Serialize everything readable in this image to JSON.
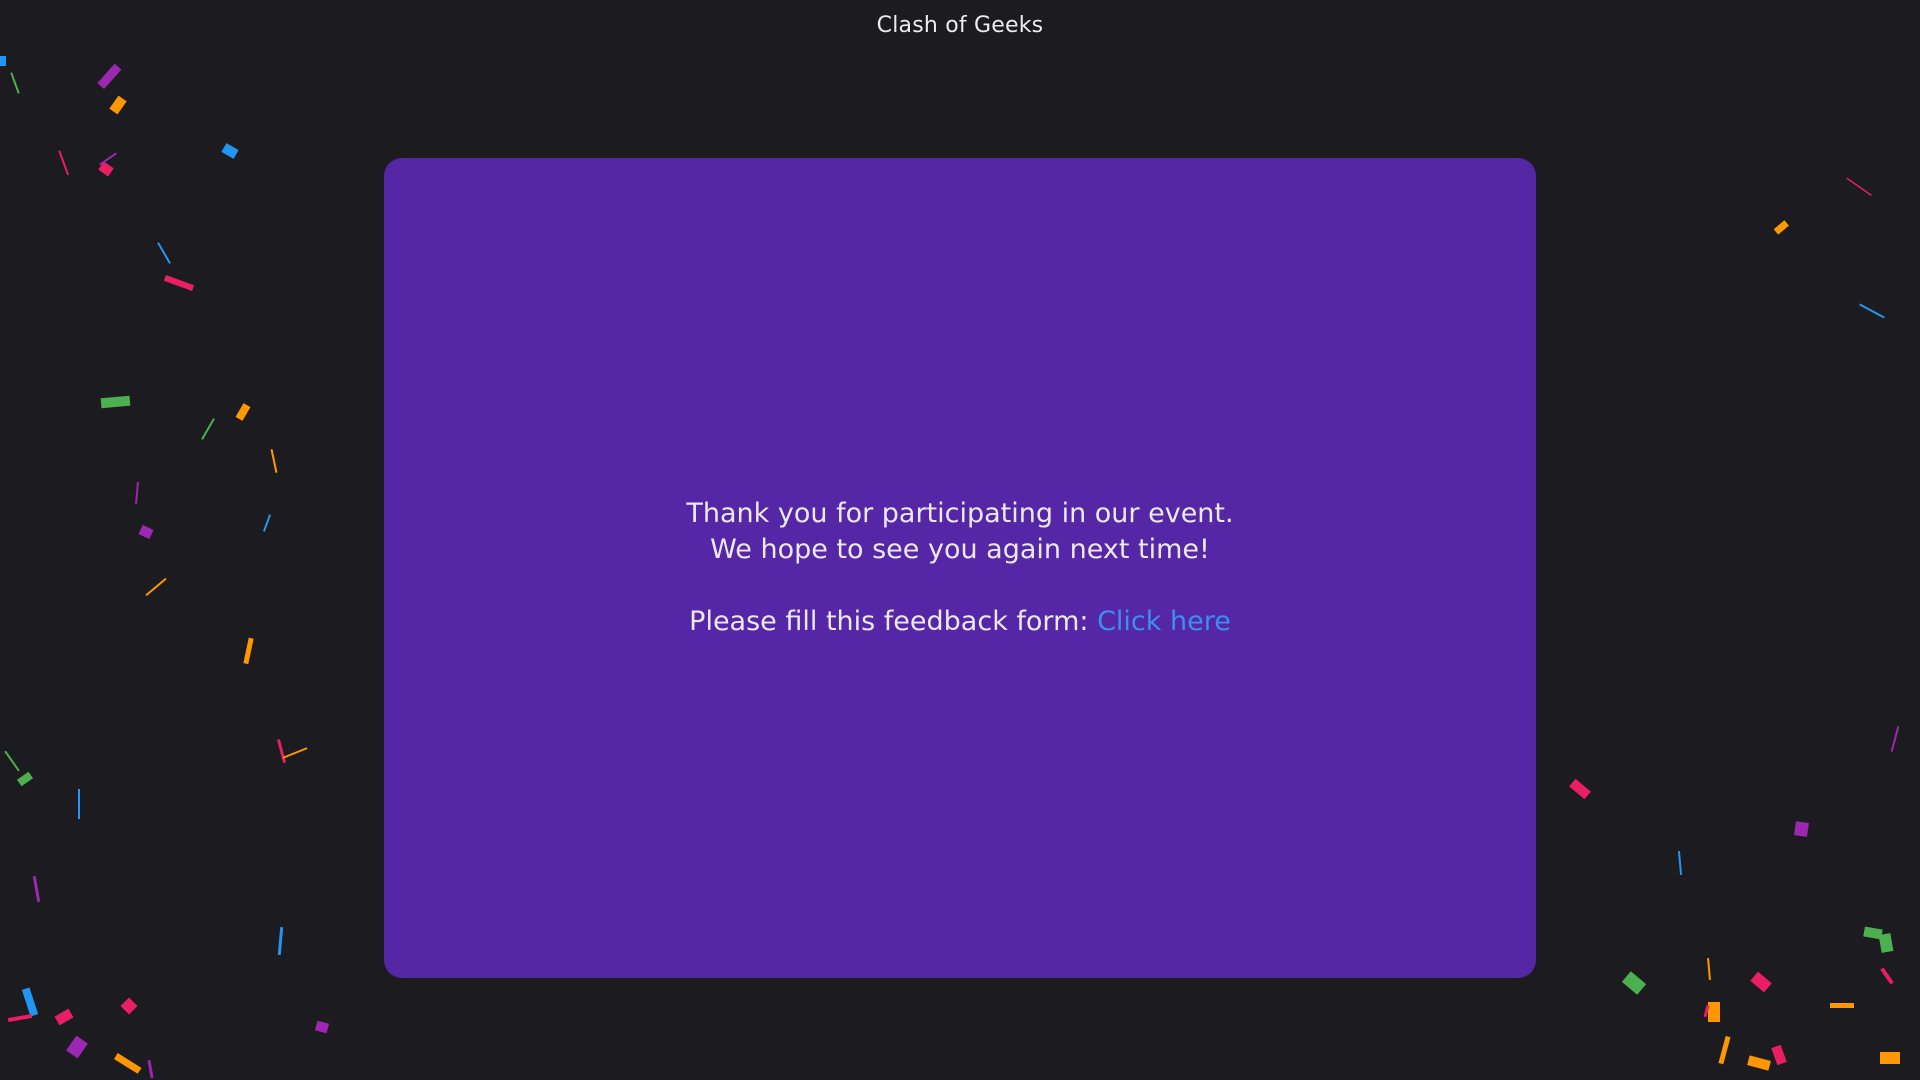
{
  "header": {
    "title": "Clash of Geeks"
  },
  "card": {
    "line1": "Thank you for participating in our event.",
    "line2": "We hope to see you again next time!",
    "feedback_prompt": "Please fill this feedback form:",
    "feedback_link_label": "Click here"
  },
  "colors": {
    "background": "#1c1b1f",
    "card": "#5526a6",
    "link": "#3b8ff0",
    "confetti": [
      "#9c27b0",
      "#ff9800",
      "#2196f3",
      "#e91e63",
      "#4caf50"
    ]
  }
}
